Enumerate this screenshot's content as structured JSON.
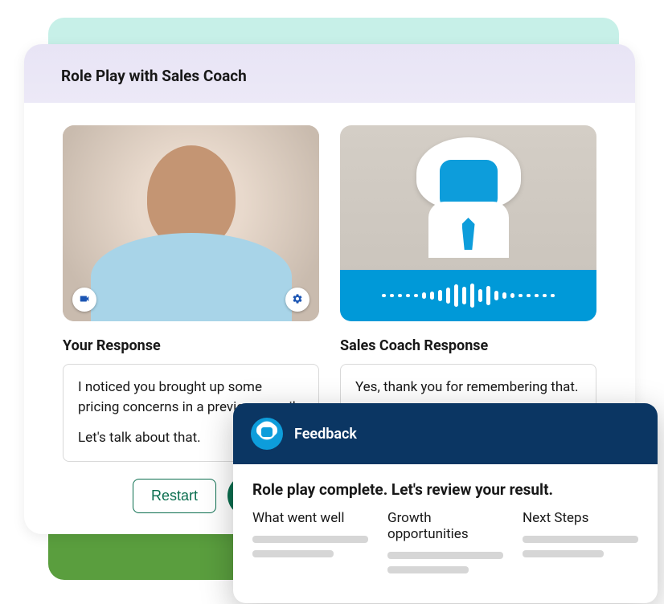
{
  "header": {
    "title": "Role Play with Sales Coach"
  },
  "user": {
    "section_title": "Your Response",
    "response_line1": "I noticed you brought up some pricing concerns in a previous email.",
    "response_line2": "Let's talk about that."
  },
  "coach": {
    "section_title": "Sales Coach Response",
    "response": "Yes, thank you for remembering that."
  },
  "controls": {
    "restart_label": "Restart"
  },
  "feedback": {
    "panel_title": "Feedback",
    "lead": "Role play complete. Let's review your result.",
    "columns": {
      "col1": "What went well",
      "col2": "Growth opportunities",
      "col3": "Next Steps"
    }
  },
  "icons": {
    "camera": "camera-icon",
    "settings": "gear-icon",
    "mic": "microphone-icon"
  }
}
